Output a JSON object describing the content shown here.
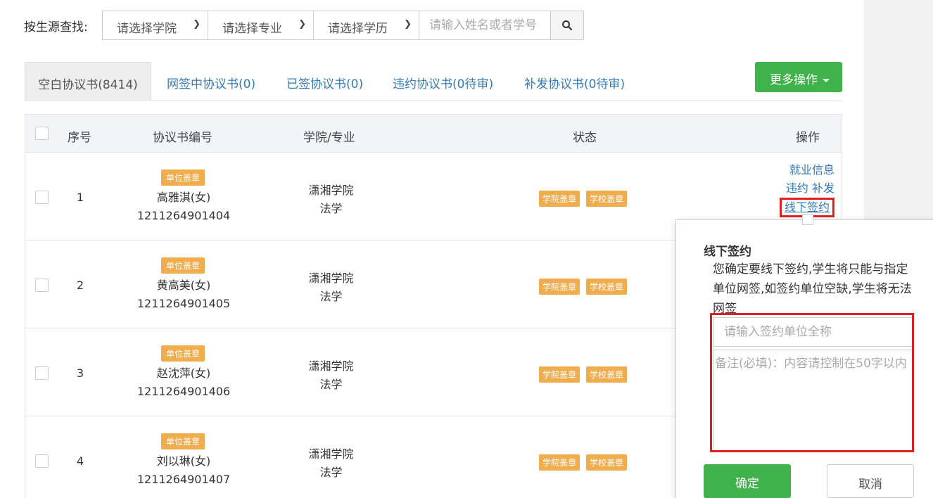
{
  "filter": {
    "label": "按生源查找:",
    "college_select": "请选择学院",
    "major_select": "请选择专业",
    "degree_select": "请选择学历",
    "search_placeholder": "请输入姓名或者学号"
  },
  "tabs": [
    {
      "label": "空白协议书(8414)"
    },
    {
      "label": "网签中协议书(0)"
    },
    {
      "label": "已签协议书(0)"
    },
    {
      "label": "违约协议书(0待审)"
    },
    {
      "label": "补发协议书(0待审)"
    }
  ],
  "more_button": "更多操作",
  "table": {
    "headers": {
      "index": "序号",
      "agreement_no": "协议书编号",
      "college_major": "学院/专业",
      "status": "状态",
      "actions": "操作"
    },
    "rows": [
      {
        "index": "1",
        "badge": "单位盖章",
        "name": "高雅淇(女)",
        "number": "1211264901404",
        "college": "潇湘学院",
        "major": "法学",
        "status1": "学院盖章",
        "status2": "学校盖章"
      },
      {
        "index": "2",
        "badge": "单位盖章",
        "name": "黄高美(女)",
        "number": "1211264901405",
        "college": "潇湘学院",
        "major": "法学",
        "status1": "学院盖章",
        "status2": "学校盖章"
      },
      {
        "index": "3",
        "badge": "单位盖章",
        "name": "赵沈萍(女)",
        "number": "1211264901406",
        "college": "潇湘学院",
        "major": "法学",
        "status1": "学院盖章",
        "status2": "学校盖章"
      },
      {
        "index": "4",
        "badge": "单位盖章",
        "name": "刘以琳(女)",
        "number": "1211264901407",
        "college": "潇湘学院",
        "major": "法学",
        "status1": "学院盖章",
        "status2": "学校盖章"
      }
    ],
    "row1_actions": {
      "employment_info": "就业信息",
      "breach": "违约",
      "reissue": "补发",
      "offline_sign": "线下签约"
    }
  },
  "popover": {
    "title": "线下签约",
    "message": "您确定要线下签约,学生将只能与指定单位网签,如签约单位空缺,学生将无法网签",
    "unit_placeholder": "请输入签约单位全称",
    "remark_placeholder": "备注(必填)：内容请控制在50字以内",
    "confirm": "确定",
    "cancel": "取消"
  },
  "colors": {
    "primary_green": "#3fb24b",
    "link_blue": "#337ab7",
    "badge_orange": "#f0ad4e",
    "highlight_red": "#e02020"
  }
}
